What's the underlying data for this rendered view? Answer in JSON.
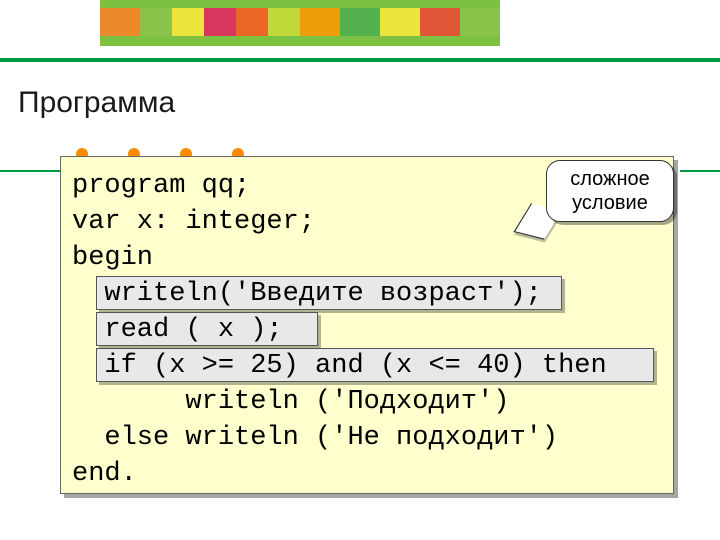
{
  "heading": "Программа",
  "callout": {
    "line1": "сложное",
    "line2": "условие"
  },
  "code": {
    "l1": "program qq;",
    "l2": "var x: integer;",
    "l3": "begin",
    "l4": "  writeln('Введите возраст');",
    "l5": "  read ( x );",
    "l6": "  if (x >= 25) and (x <= 40) then",
    "l7": "       writeln ('Подходит')",
    "l8": "  else writeln ('Не подходит')",
    "l9": "end."
  }
}
